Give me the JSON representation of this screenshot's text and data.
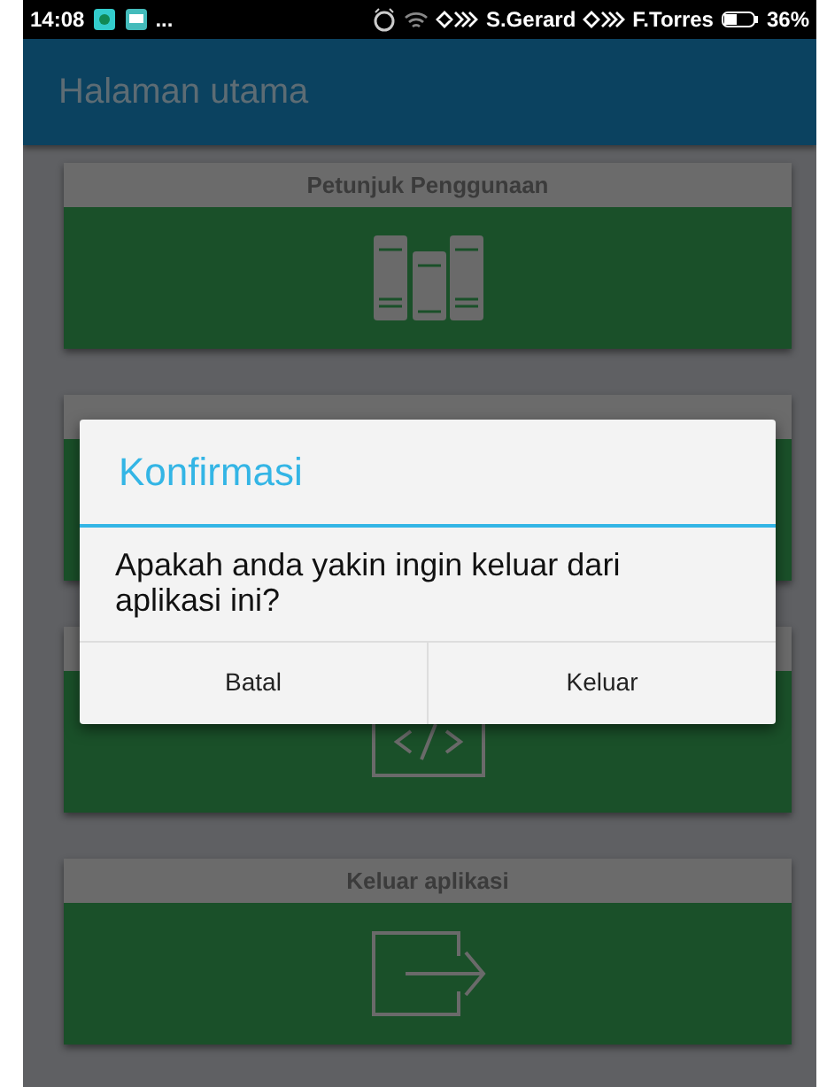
{
  "status_bar": {
    "time": "14:08",
    "more": "...",
    "carrier_1": "S.Gerard",
    "carrier_2": "F.Torres",
    "battery": "36%"
  },
  "app_bar": {
    "title": "Halaman utama"
  },
  "menu_cards": [
    {
      "title": "Petunjuk Penggunaan",
      "kind": "books"
    },
    {
      "kind": "hidden"
    },
    {
      "kind": "code"
    },
    {
      "title": "Keluar aplikasi",
      "kind": "exit"
    }
  ],
  "dialog": {
    "title": "Konfirmasi",
    "message": "Apakah anda yakin ingin keluar dari aplikasi ini?",
    "buttons": [
      "Batal",
      "Keluar"
    ]
  }
}
